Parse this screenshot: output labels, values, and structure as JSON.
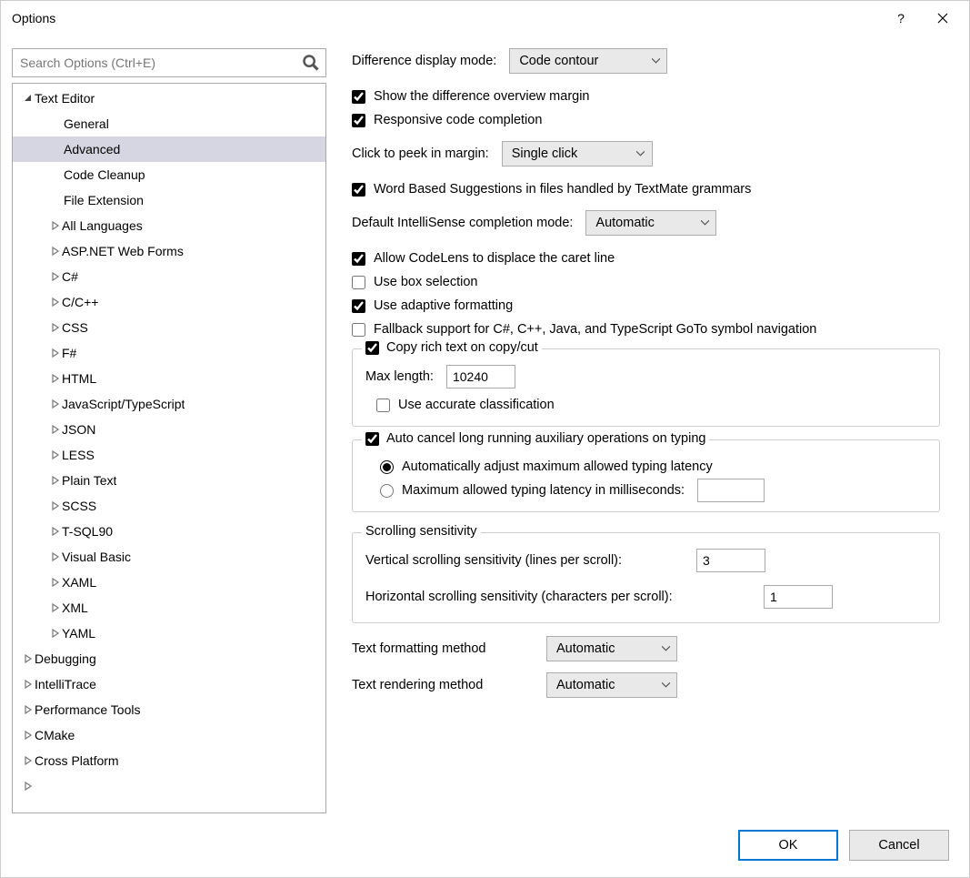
{
  "title": "Options",
  "search_placeholder": "Search Options (Ctrl+E)",
  "tree": {
    "text_editor": "Text Editor",
    "general": "General",
    "advanced": "Advanced",
    "code_cleanup": "Code Cleanup",
    "file_extension": "File Extension",
    "all_languages": "All Languages",
    "aspnet": "ASP.NET Web Forms",
    "csharp": "C#",
    "ccpp": "C/C++",
    "css": "CSS",
    "fsharp": "F#",
    "html": "HTML",
    "jsts": "JavaScript/TypeScript",
    "json": "JSON",
    "less": "LESS",
    "plaintext": "Plain Text",
    "scss": "SCSS",
    "tsql": "T-SQL90",
    "vb": "Visual Basic",
    "xaml": "XAML",
    "xml": "XML",
    "yaml": "YAML",
    "debugging": "Debugging",
    "intellitrace": "IntelliTrace",
    "perftools": "Performance Tools",
    "cmake": "CMake",
    "crossplatform": "Cross Platform"
  },
  "settings": {
    "diff_mode_label": "Difference display mode:",
    "diff_mode_value": "Code contour",
    "show_diff_margin": "Show the difference overview margin",
    "responsive_completion": "Responsive code completion",
    "peek_label": "Click to peek in margin:",
    "peek_value": "Single click",
    "word_suggestions": "Word Based Suggestions in files handled by TextMate grammars",
    "intellisense_label": "Default IntelliSense completion mode:",
    "intellisense_value": "Automatic",
    "allow_codelens": "Allow CodeLens to displace the caret line",
    "box_selection": "Use box selection",
    "adaptive_formatting": "Use adaptive formatting",
    "fallback_goto": "Fallback support for C#, C++, Java, and TypeScript GoTo symbol navigation",
    "copy_rich": "Copy rich text on copy/cut",
    "max_length_label": "Max length:",
    "max_length_value": "10240",
    "accurate_classification": "Use accurate classification",
    "auto_cancel": "Auto cancel long running auxiliary operations on typing",
    "auto_adjust": "Automatically adjust maximum allowed typing latency",
    "max_latency": "Maximum allowed typing latency in milliseconds:",
    "max_latency_value": "",
    "scroll_title": "Scrolling sensitivity",
    "vscroll_label": "Vertical scrolling sensitivity (lines per scroll):",
    "vscroll_value": "3",
    "hscroll_label": "Horizontal scrolling sensitivity (characters per scroll):",
    "hscroll_value": "1",
    "formatting_label": "Text formatting method",
    "formatting_value": "Automatic",
    "rendering_label": "Text rendering method",
    "rendering_value": "Automatic"
  },
  "buttons": {
    "ok": "OK",
    "cancel": "Cancel"
  }
}
